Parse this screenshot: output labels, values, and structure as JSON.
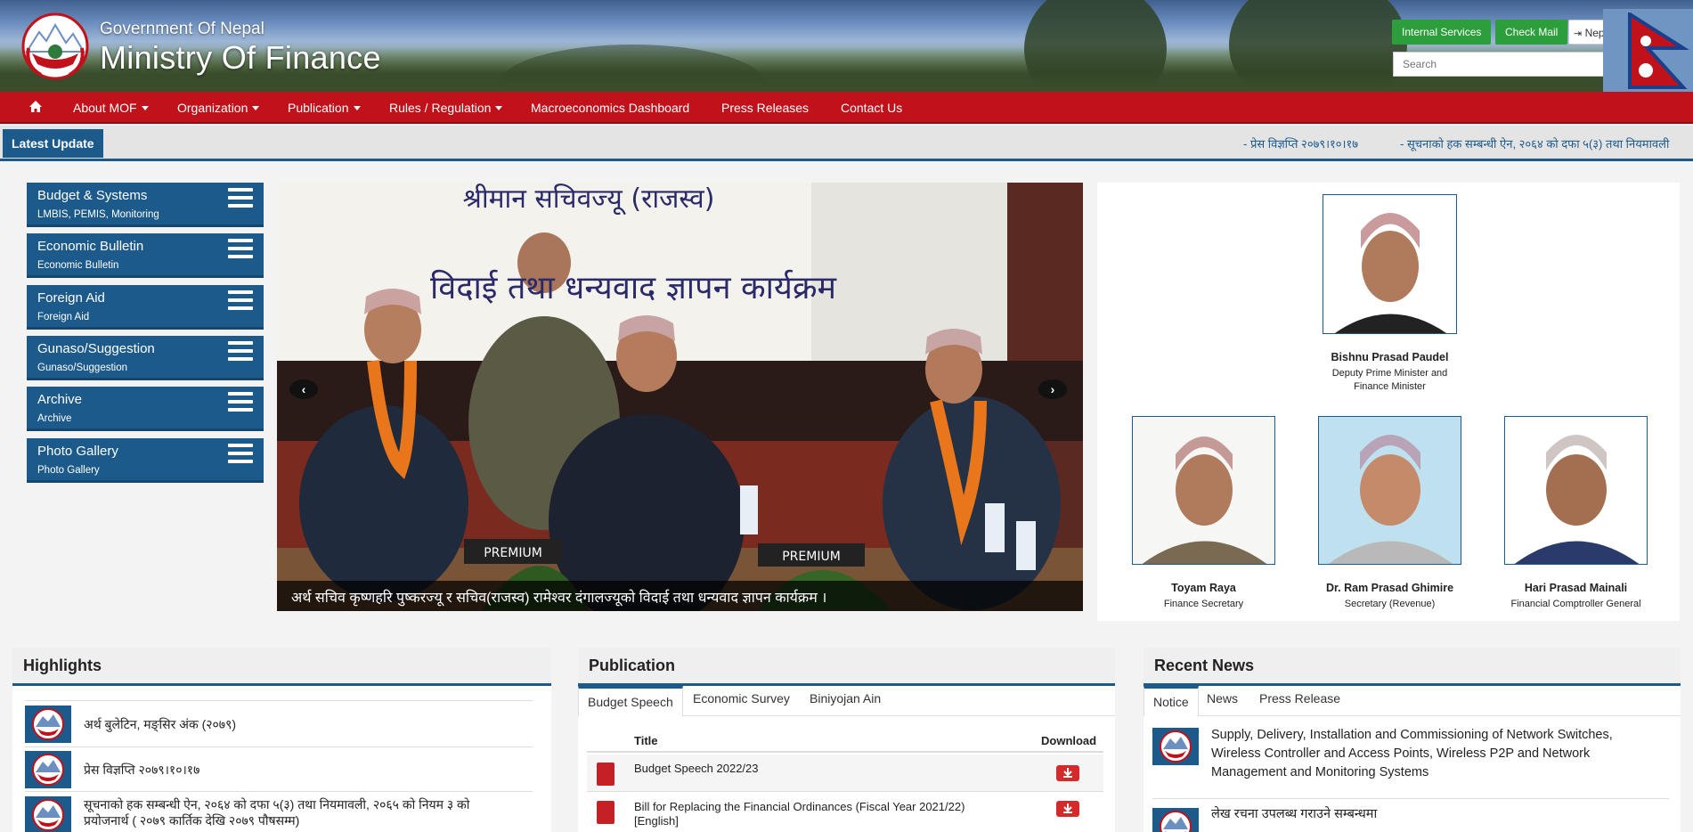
{
  "header": {
    "gov_label": "Government Of Nepal",
    "ministry_label": "Ministry Of Finance",
    "internal_services": "Internal Services",
    "check_mail": "Check Mail",
    "nepali": "Nepali",
    "search_placeholder": "Search"
  },
  "nav": {
    "items": [
      "About MOF",
      "Organization",
      "Publication",
      "Rules / Regulation",
      "Macroeconomics Dashboard",
      "Press Releases",
      "Contact Us"
    ]
  },
  "ticker": {
    "label": "Latest Update",
    "items": [
      "- प्रेस विज्ञप्ति २०७९।१०।१७",
      "- सूचनाको हक सम्बन्धी ऐन, २०६४ को दफा ५(३) तथा नियमावली"
    ]
  },
  "sidebar": {
    "items": [
      {
        "title": "Budget & Systems",
        "sub": "LMBIS, PEMIS, Monitoring"
      },
      {
        "title": "Economic Bulletin",
        "sub": "Economic Bulletin"
      },
      {
        "title": "Foreign Aid",
        "sub": "Foreign Aid"
      },
      {
        "title": "Gunaso/Suggestion",
        "sub": "Gunaso/Suggestion"
      },
      {
        "title": "Archive",
        "sub": "Archive"
      },
      {
        "title": "Photo Gallery",
        "sub": "Photo Gallery"
      }
    ]
  },
  "slider": {
    "caption": "अर्थ सचिव कृष्णहरि पुष्करज्यू र सचिव(राजस्व) रामेश्वर दंगालज्यूको विदाई तथा धन्यवाद ज्ञापन कार्यक्रम ।",
    "banner_top": "श्रीमान सचिवज्यू (राजस्व)",
    "banner_main": "विदाई तथा धन्यवाद ज्ञापन कार्यक्रम",
    "nameplate_1": "PREMIUM",
    "nameplate_2": "PREMIUM"
  },
  "officials": {
    "minister": {
      "name": "Bishnu Prasad Paudel",
      "role_1": "Deputy Prime Minister and",
      "role_2": "Finance Minister"
    },
    "others": [
      {
        "name": "Toyam Raya",
        "role": "Finance Secretary"
      },
      {
        "name": "Dr. Ram Prasad Ghimire",
        "role": "Secretary (Revenue)"
      },
      {
        "name": "Hari Prasad Mainali",
        "role": "Financial Comptroller General"
      }
    ]
  },
  "highlights": {
    "title": "Highlights",
    "items": [
      "अर्थ बुलेटिन, मङ्सिर अंक (२०७९)",
      "प्रेस विज्ञप्ति २०७९।१०।१७",
      "सूचनाको हक सम्बन्धी ऐन, २०६४ को दफा ५(३) तथा नियमावली, २०६५ को नियम ३ को",
      "प्रयोजनार्थ ( २०७९ कार्तिक देखि २०७९ पौषसम्म)"
    ]
  },
  "publication": {
    "title": "Publication",
    "tabs": [
      "Budget Speech",
      "Economic Survey",
      "Biniyojan Ain"
    ],
    "col_title": "Title",
    "col_download": "Download",
    "rows": [
      "Budget Speech 2022/23",
      "Bill for Replacing the Financial Ordinances (Fiscal Year 2021/22)",
      "[English]"
    ]
  },
  "news": {
    "title": "Recent News",
    "tabs": [
      "Notice",
      "News",
      "Press Release"
    ],
    "items": [
      "Supply, Delivery, Installation and Commissioning of Network Switches,",
      "Wireless Controller and Access Points, Wireless P2P and Network",
      "Management and Monitoring Systems",
      "लेख रचना उपलब्ध गराउने सम्बन्धमा"
    ]
  },
  "colors": {
    "nav_red": "#c1121c",
    "brand_blue": "#1c5a8c",
    "button_green": "#2d9e3c"
  }
}
